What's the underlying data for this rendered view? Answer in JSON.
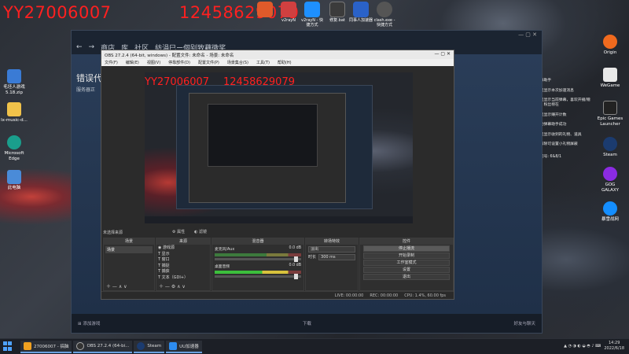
{
  "watermarks": {
    "left": "YY27006007",
    "right": "12458629079"
  },
  "top_tray_icons": [
    {
      "label": "",
      "color": "#e05a2a"
    },
    {
      "label": "v2rayN",
      "color": "#d04040"
    },
    {
      "label": "v2rayN - 快捷方式",
      "color": "#1e90ff"
    },
    {
      "label": "修复.bat",
      "color": "#3b3b3b"
    },
    {
      "label": "同事人加速器",
      "color": "#2a62c8"
    },
    {
      "label": "clash.exe - 快捷方式",
      "color": "#555"
    }
  ],
  "desktop_icons_left": [
    {
      "label": "毛坯人游戏 5.18.zip",
      "color": "#3a7bd5"
    },
    {
      "label": "lx-music-d...",
      "color": "#f0c24a"
    },
    {
      "label": "Microsoft Edge",
      "color": "#1a9e8c"
    },
    {
      "label": "此电脑",
      "color": "#4a8bd8"
    }
  ],
  "desktop_icons_right": [
    {
      "label": "Origin",
      "color": "#f06a1e"
    },
    {
      "label": "WeGame",
      "color": "#e8e8e8"
    },
    {
      "label": "Epic Games Launcher",
      "color": "#222"
    },
    {
      "label": "Steam",
      "color": "#1b3b6f"
    },
    {
      "label": "GOG GALAXY",
      "color": "#8b2be2"
    },
    {
      "label": "暴雪战网",
      "color": "#148eff"
    }
  ],
  "side_text": [
    "弹幕助手",
    "这里显示本次加速消息",
    "这里显示当前弹幕，喜欢开播/赠送，粉丝榜在",
    "这里显示赚开计数",
    "启动弹幕助手成功",
    "这里显示收到的礼物、道具",
    "已解除可设置小礼物屏蔽",
    "房间号: 6&8/1"
  ],
  "steam": {
    "nav": [
      "商店",
      "库",
      "社区",
      "紡涓巳ー個别致藕微奖"
    ],
    "heading": "错误代",
    "subtext": "服务器正",
    "footer_left": "添加游戏",
    "footer_center": "下载",
    "footer_right": "好友与聊天"
  },
  "obs": {
    "title": "OBS 27.2.4 (64-bit, windows) - 配置文件: 未命名 - 场景: 未命名",
    "menu": [
      "文件(F)",
      "编辑(E)",
      "视图(V)",
      "停靠部件(D)",
      "配置文件(P)",
      "场景集合(S)",
      "工具(T)",
      "帮助(H)"
    ],
    "source_bar": {
      "properties": "属性",
      "filters": "滤镜"
    },
    "panels": {
      "scenes": {
        "header": "场景",
        "items": [
          "场景"
        ]
      },
      "sources": {
        "header": "来源",
        "items": [
          "游戏源",
          "显示",
          "窗口",
          "捕捉",
          "捕获",
          "文本（GDI+）"
        ]
      },
      "mixer": {
        "header": "混音器",
        "channels": [
          {
            "name": "麦克风/Aux",
            "level": "0.0 dB"
          },
          {
            "name": "桌面音频",
            "level": "0.0 dB"
          }
        ]
      },
      "transitions": {
        "header": "转场特效",
        "type": "淡出",
        "duration_label": "时长",
        "duration_value": "300 ms"
      },
      "controls": {
        "header": "控件",
        "buttons": [
          "停止播流",
          "开始录制",
          "工作室模式",
          "设置",
          "退出"
        ]
      }
    },
    "top_label": "未选择来源",
    "status": {
      "live": "LIVE: 00:00:00",
      "rec": "REC: 00:00:00",
      "cpu": "CPU: 1.4%, 60.00 fps"
    }
  },
  "taskbar": {
    "apps": [
      {
        "label": "27006007 - 搞脑",
        "color": "#f0a020"
      },
      {
        "label": "OBS 27.2.4 (64-bi...",
        "color": "#333"
      },
      {
        "label": "Steam",
        "color": "#1b3b6f"
      },
      {
        "label": "UU加速器",
        "color": "#2d8cf0"
      }
    ],
    "time": "14:29",
    "date": "2022/6/18"
  }
}
